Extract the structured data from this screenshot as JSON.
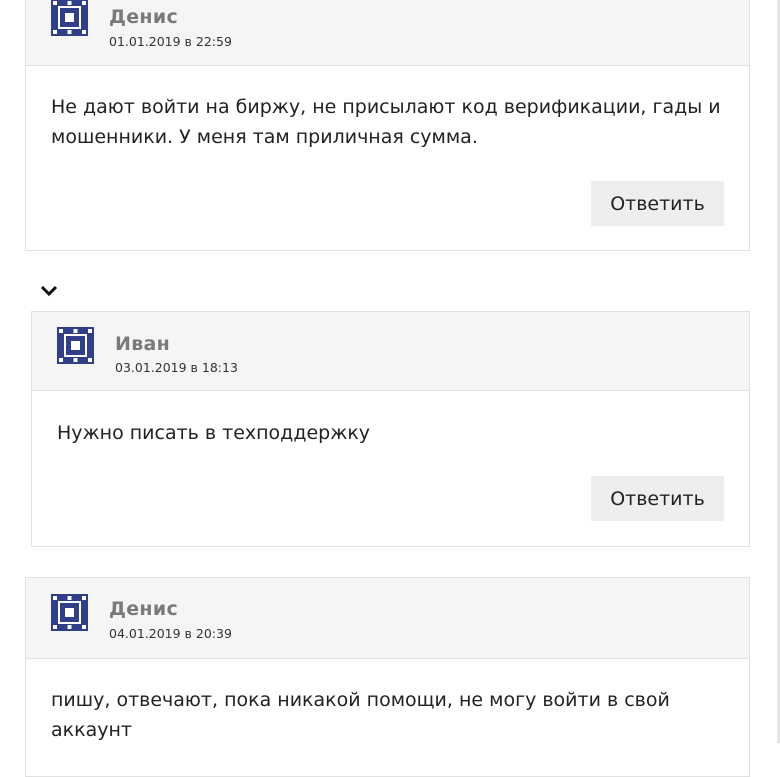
{
  "comments": [
    {
      "author": "Денис",
      "date": "01.01.2019 в 22:59",
      "text": "Не дают войти на биржу, не присылают код верификации, гады и мошенники. У меня там приличная сумма.",
      "reply_label": "Ответить"
    },
    {
      "author": "Иван",
      "date": "03.01.2019 в 18:13",
      "text": "Нужно писать в техподдержку",
      "reply_label": "Ответить"
    },
    {
      "author": "Денис",
      "date": "04.01.2019 в 20:39",
      "text": "пишу, отвечают, пока никакой помощи, не могу войти в свой аккаунт"
    }
  ],
  "icons": {
    "avatar": "pattern-avatar-icon",
    "replies_toggle": "chevron-down-icon"
  },
  "colors": {
    "header_bg": "#f5f5f5",
    "border": "#e1e1e1",
    "button_bg": "#eeeeee",
    "author": "#7a7a7a",
    "avatar": "#2f3f8a"
  }
}
